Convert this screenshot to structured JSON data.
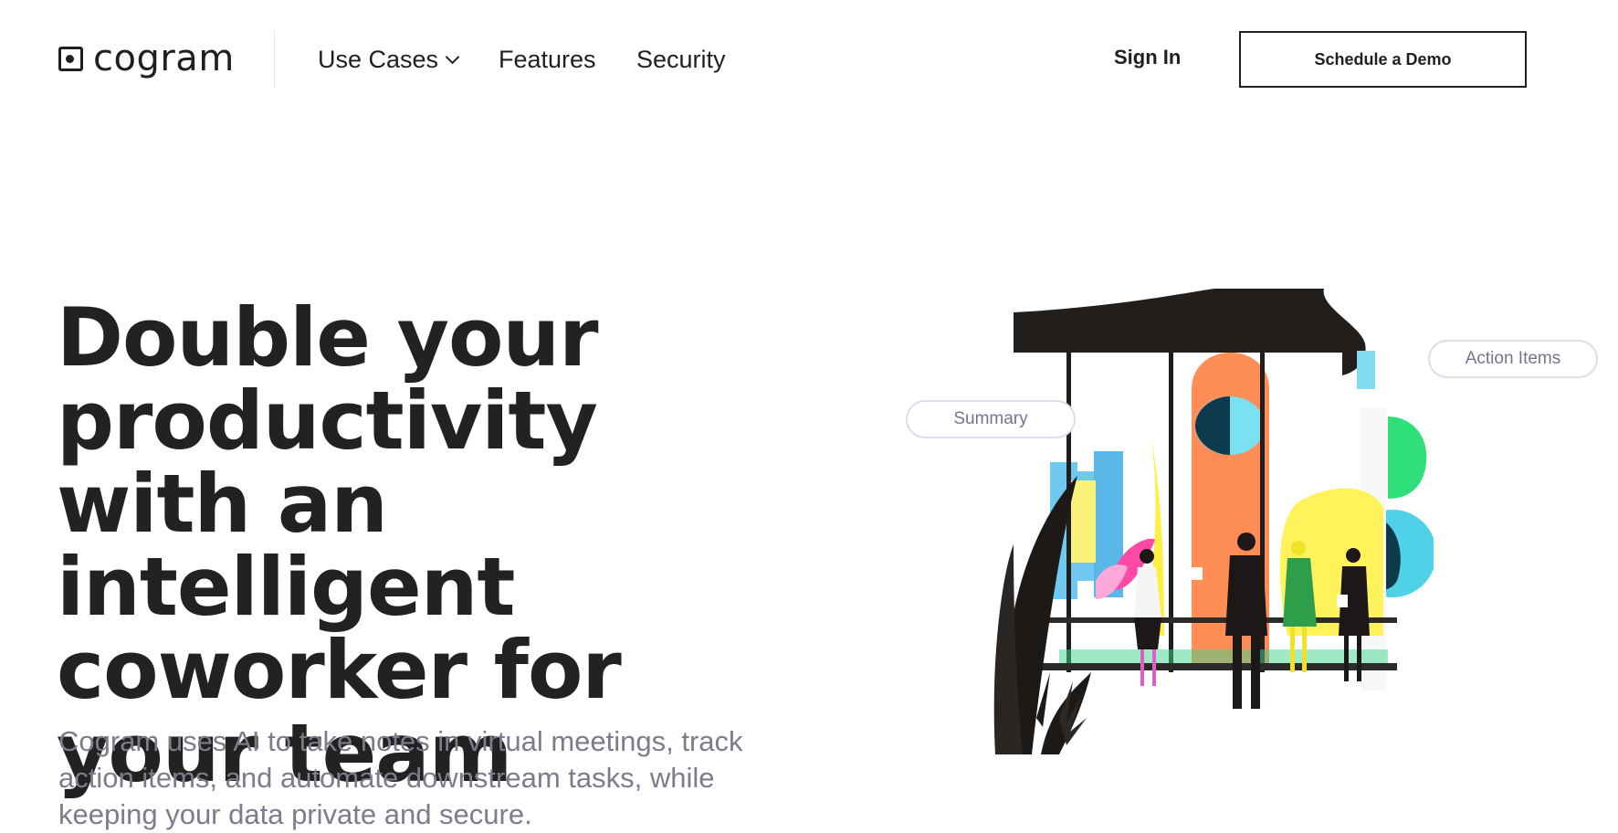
{
  "brand": {
    "name": "cogram"
  },
  "nav": {
    "links": [
      {
        "label": "Use Cases"
      },
      {
        "label": "Features"
      },
      {
        "label": "Security"
      }
    ],
    "sign_in": "Sign In",
    "cta": "Schedule a Demo"
  },
  "hero": {
    "title": "Double your productivity with an intelligent coworker for your team",
    "subtitle": "Cogram uses AI to take notes in virtual meetings, track action items, and automate downstream tasks, while keeping your data private and secure."
  },
  "illustration": {
    "pills": {
      "summary": "Summary",
      "action_items": "Action Items"
    }
  }
}
